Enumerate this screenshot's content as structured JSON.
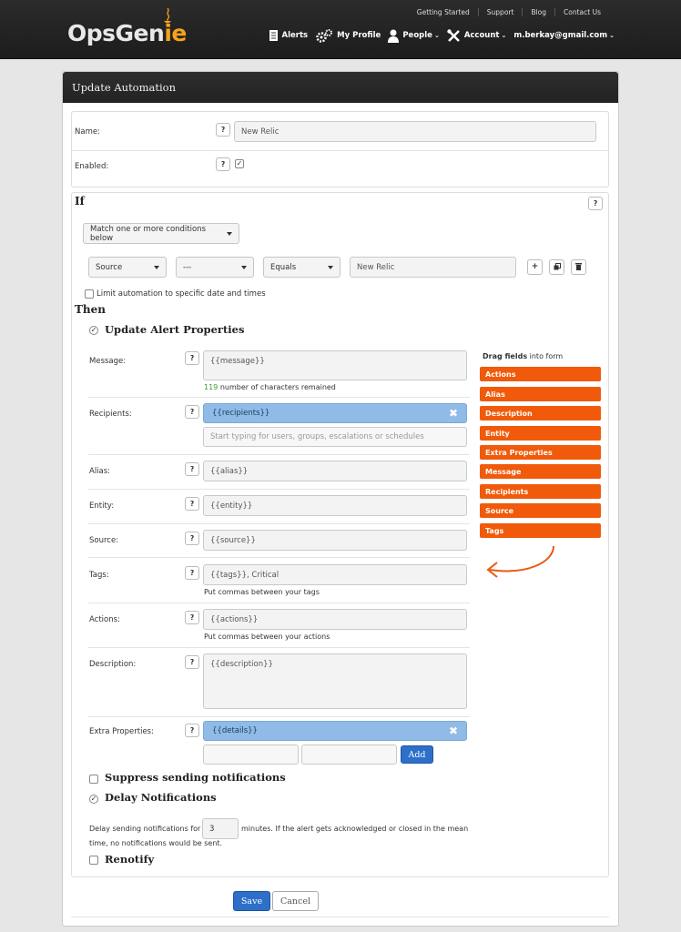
{
  "header": {
    "logo_ops": "OpsGen",
    "logo_ie": "ie",
    "top_links": [
      "Getting Started",
      "Support",
      "Blog",
      "Contact Us"
    ],
    "nav": {
      "alerts": "Alerts",
      "my_profile": "My Profile",
      "people": "People",
      "account": "Account",
      "user_email": "m.berkay@gmail.com"
    }
  },
  "panel": {
    "title": "Update Automation",
    "name_label": "Name:",
    "name_value": "New Relic",
    "enabled_label": "Enabled:",
    "help_glyph": "?"
  },
  "if_section": {
    "title": "If",
    "match_select": "Match one or more conditions below",
    "condition": {
      "field": "Source",
      "op_prefix": "---",
      "operator": "Equals",
      "value": "New Relic"
    },
    "limit_label": "Limit automation to specific date and times"
  },
  "then_section": {
    "title": "Then",
    "update_props_label": "Update Alert Properties",
    "message_label": "Message:",
    "message_value": "{{message}}",
    "message_count": "119",
    "message_hint": " number of characters remained",
    "recipients_label": "Recipients:",
    "recipients_tag": "{{recipients}}",
    "recipients_placeholder": "Start typing for users, groups, escalations or schedules",
    "alias_label": "Alias:",
    "alias_value": "{{alias}}",
    "entity_label": "Entity:",
    "entity_value": "{{entity}}",
    "source_label": "Source:",
    "source_value": "{{source}}",
    "tags_label": "Tags:",
    "tags_value": "{{tags}}, Critical",
    "tags_hint": "Put commas between your tags",
    "actions_label": "Actions:",
    "actions_value": "{{actions}}",
    "actions_hint": "Put commas between your actions",
    "description_label": "Description:",
    "description_value": "{{description}}",
    "extra_label": "Extra Properties:",
    "extra_tag": "{{details}}",
    "add_label": "Add",
    "suppress_label": "Suppress sending notifications",
    "delay_label": "Delay Notifications",
    "delay_text_1": "Delay sending notifications for",
    "delay_minutes": "3",
    "delay_text_2": "minutes. If the alert gets acknowledged or closed in the mean",
    "delay_text_3": "time, no notifications would be sent.",
    "renotify_label": "Renotify"
  },
  "drag_fields": {
    "title_bold": "Drag fields",
    "title_rest": " into form",
    "items": [
      "Actions",
      "Alias",
      "Description",
      "Entity",
      "Extra Properties",
      "Message",
      "Recipients",
      "Source",
      "Tags"
    ]
  },
  "footer": {
    "save_label": "Save",
    "cancel_label": "Cancel"
  },
  "colors": {
    "accent_orange": "#f05a0a",
    "tag_blue": "#8fbbe6",
    "save_blue": "#2d6fc9",
    "header_dark": "#222222"
  }
}
